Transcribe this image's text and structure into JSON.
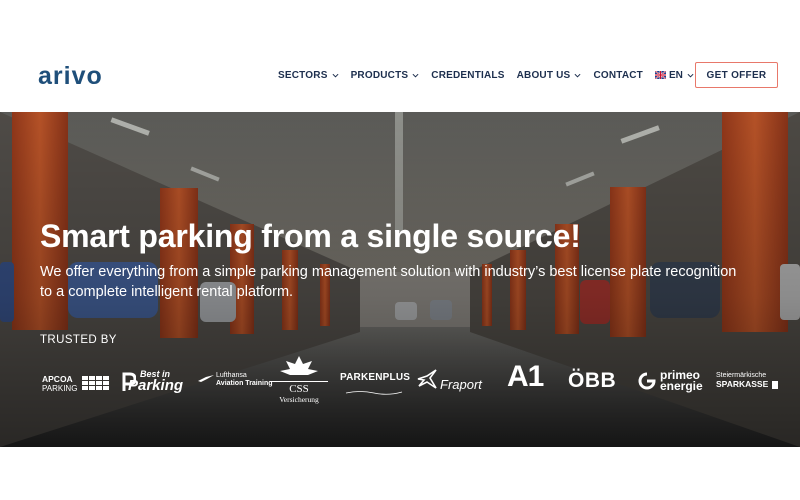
{
  "brand": {
    "name": "ARIVO"
  },
  "nav": {
    "items": [
      {
        "label": "SECTORS",
        "has_dropdown": true
      },
      {
        "label": "PRODUCTS",
        "has_dropdown": true
      },
      {
        "label": "CREDENTIALS",
        "has_dropdown": false
      },
      {
        "label": "ABOUT US",
        "has_dropdown": true
      },
      {
        "label": "CONTACT",
        "has_dropdown": false
      }
    ],
    "language": {
      "label": "EN",
      "flag": "uk-flag-icon"
    },
    "cta_label": "GET OFFER"
  },
  "hero": {
    "title": "Smart parking from a single source!",
    "subtitle": "We offer everything from a simple parking management solution with industry’s best license plate recognition to a complete intelligent rental platform.",
    "trusted_label": "TRUSTED BY"
  },
  "partners": {
    "apcoa_top": "APCOA",
    "apcoa_bottom": "PARKING",
    "bestin_top": "Best in",
    "bestin_bottom": "Parking",
    "lufthansa_top": "Lufthansa",
    "lufthansa_bottom": "Aviation Training",
    "css_top": "CSS",
    "css_bottom": "Versicherung",
    "parkenplus": "PARKENPLUS",
    "fraport": "Fraport",
    "a1": "A1",
    "obb": "ÖBB",
    "primeo_top": "primeo",
    "primeo_bottom": "energie",
    "sparkasse_top": "Steiermärkische",
    "sparkasse_bottom": "SPARKASSE"
  },
  "colors": {
    "navy": "#1d2f4e",
    "brand_blue": "#1f4f7a",
    "cta_border": "#e8786a",
    "pillar_orange": "#c9542c"
  }
}
